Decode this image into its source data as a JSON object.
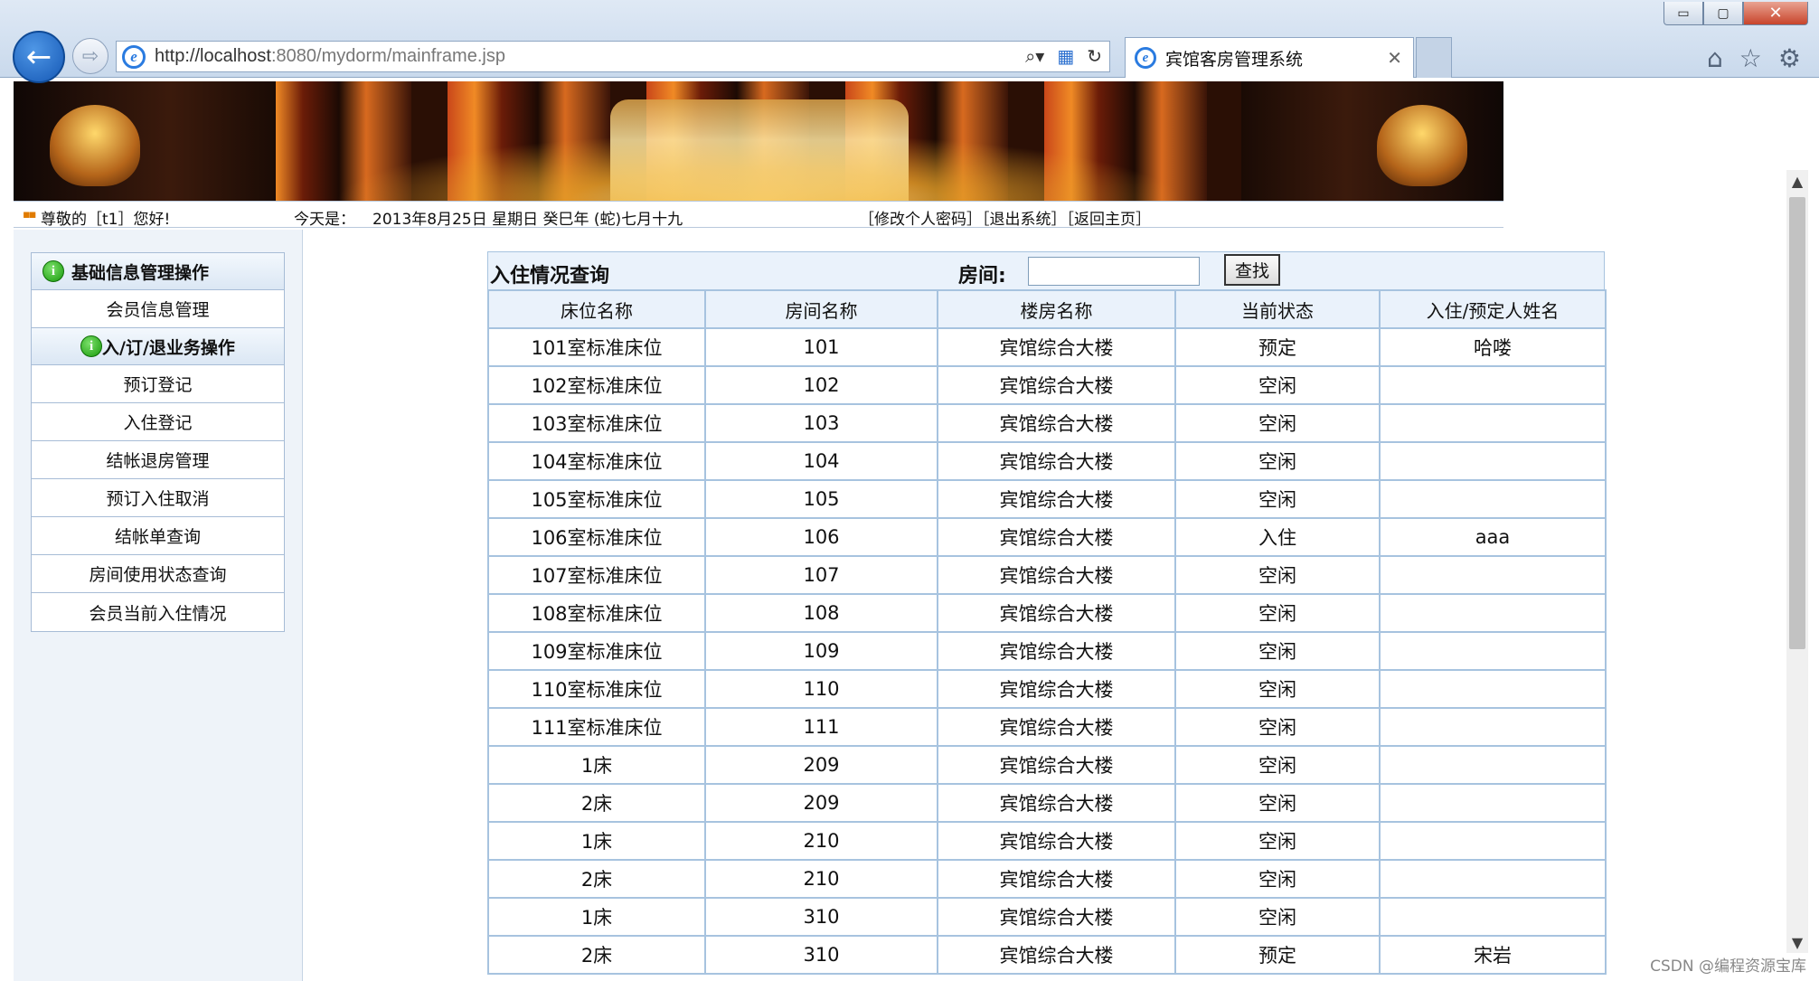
{
  "browser": {
    "url_host": "http://localhost",
    "url_rest": ":8080/mydorm/mainframe.jsp",
    "tab_title": "宾馆客房管理系统",
    "tab_close": "✕",
    "win_min": "▭",
    "win_max": "▢",
    "win_close": "✕",
    "ie_glyph": "e"
  },
  "info_bar": {
    "bullet": "▪▪",
    "greeting": "尊敬的［t1］您好!",
    "today_label": "今天是：",
    "date": "2013年8月25日  星期日  癸巳年 (蛇)七月十九",
    "links": "［修改个人密码］［退出系统］［返回主页］"
  },
  "sidebar": {
    "section1": "基础信息管理操作",
    "section1_items": [
      "会员信息管理"
    ],
    "section2": "入/订/退业务操作",
    "section2_items": [
      "预订登记",
      "入住登记",
      "结帐退房管理",
      "预订入住取消",
      "结帐单查询",
      "房间使用状态查询",
      "会员当前入住情况"
    ]
  },
  "query": {
    "title": "入住情况查询",
    "room_label": "房间:",
    "room_value": "",
    "search_label": "查找"
  },
  "table": {
    "headers": [
      "床位名称",
      "房间名称",
      "楼房名称",
      "当前状态",
      "入住/预定人姓名"
    ],
    "rows": [
      [
        "101室标准床位",
        "101",
        "宾馆综合大楼",
        "预定",
        "哈喽"
      ],
      [
        "102室标准床位",
        "102",
        "宾馆综合大楼",
        "空闲",
        ""
      ],
      [
        "103室标准床位",
        "103",
        "宾馆综合大楼",
        "空闲",
        ""
      ],
      [
        "104室标准床位",
        "104",
        "宾馆综合大楼",
        "空闲",
        ""
      ],
      [
        "105室标准床位",
        "105",
        "宾馆综合大楼",
        "空闲",
        ""
      ],
      [
        "106室标准床位",
        "106",
        "宾馆综合大楼",
        "入住",
        "aaa"
      ],
      [
        "107室标准床位",
        "107",
        "宾馆综合大楼",
        "空闲",
        ""
      ],
      [
        "108室标准床位",
        "108",
        "宾馆综合大楼",
        "空闲",
        ""
      ],
      [
        "109室标准床位",
        "109",
        "宾馆综合大楼",
        "空闲",
        ""
      ],
      [
        "110室标准床位",
        "110",
        "宾馆综合大楼",
        "空闲",
        ""
      ],
      [
        "111室标准床位",
        "111",
        "宾馆综合大楼",
        "空闲",
        ""
      ],
      [
        "1床",
        "209",
        "宾馆综合大楼",
        "空闲",
        ""
      ],
      [
        "2床",
        "209",
        "宾馆综合大楼",
        "空闲",
        ""
      ],
      [
        "1床",
        "210",
        "宾馆综合大楼",
        "空闲",
        ""
      ],
      [
        "2床",
        "210",
        "宾馆综合大楼",
        "空闲",
        ""
      ],
      [
        "1床",
        "310",
        "宾馆综合大楼",
        "空闲",
        ""
      ],
      [
        "2床",
        "310",
        "宾馆综合大楼",
        "预定",
        "宋岩"
      ]
    ]
  },
  "watermark": "CSDN @编程资源宝库",
  "icons": {
    "back": "back-arrow-icon",
    "forward": "forward-arrow-icon",
    "search": "search-icon",
    "refresh": "refresh-icon",
    "home": "home-icon",
    "favorites": "star-icon",
    "settings": "gear-icon",
    "info": "info-icon"
  },
  "colors": {
    "accent": "#1558b5",
    "table_border": "#a7c3df",
    "header_bg": "#eaf2fb",
    "info_green": "#189a0a"
  }
}
